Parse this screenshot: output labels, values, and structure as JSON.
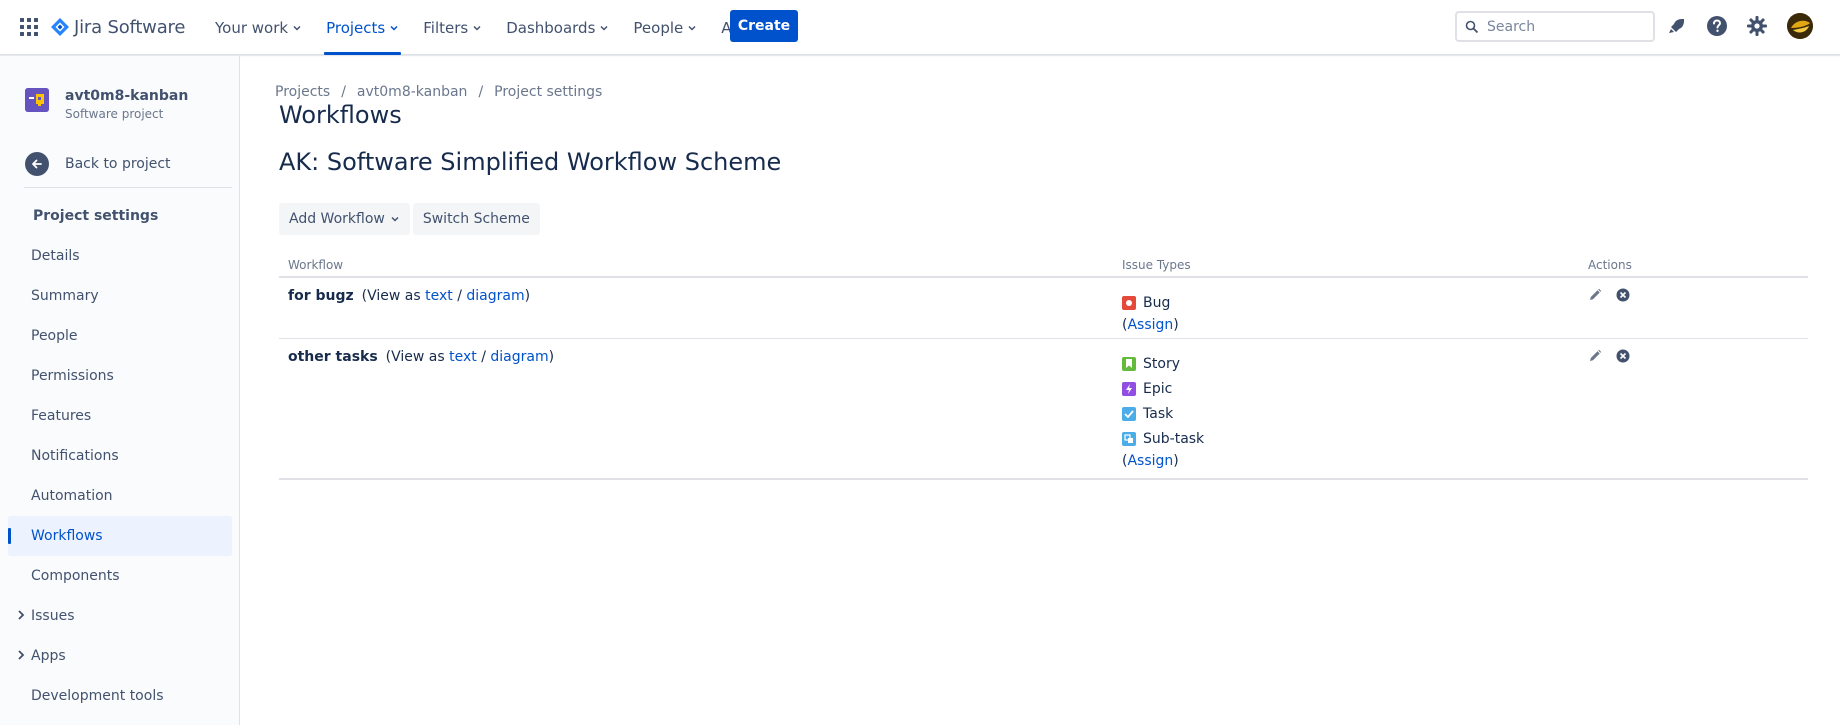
{
  "app": {
    "name": "Jira Software"
  },
  "topnav": {
    "items": [
      {
        "label": "Your work",
        "active": false
      },
      {
        "label": "Projects",
        "active": true
      },
      {
        "label": "Filters",
        "active": false
      },
      {
        "label": "Dashboards",
        "active": false
      },
      {
        "label": "People",
        "active": false
      },
      {
        "label": "Apps",
        "active": false
      }
    ],
    "create_label": "Create",
    "search_placeholder": "Search",
    "icons": [
      "apps-grid-icon",
      "notifications-icon",
      "help-icon",
      "settings-icon",
      "user-avatar"
    ]
  },
  "sidebar": {
    "project_name": "avt0m8-kanban",
    "project_type": "Software project",
    "back_label": "Back to project",
    "section_title": "Project settings",
    "items": [
      {
        "label": "Details",
        "active": false,
        "expandable": false
      },
      {
        "label": "Summary",
        "active": false,
        "expandable": false
      },
      {
        "label": "People",
        "active": false,
        "expandable": false
      },
      {
        "label": "Permissions",
        "active": false,
        "expandable": false
      },
      {
        "label": "Features",
        "active": false,
        "expandable": false
      },
      {
        "label": "Notifications",
        "active": false,
        "expandable": false
      },
      {
        "label": "Automation",
        "active": false,
        "expandable": false
      },
      {
        "label": "Workflows",
        "active": true,
        "expandable": false
      },
      {
        "label": "Components",
        "active": false,
        "expandable": false
      },
      {
        "label": "Issues",
        "active": false,
        "expandable": true
      },
      {
        "label": "Apps",
        "active": false,
        "expandable": true
      },
      {
        "label": "Development tools",
        "active": false,
        "expandable": false
      }
    ]
  },
  "breadcrumb": [
    "Projects",
    "avt0m8-kanban",
    "Project settings"
  ],
  "page": {
    "title": "Workflows",
    "scheme_title": "AK: Software Simplified Workflow Scheme",
    "add_workflow_label": "Add Workflow",
    "switch_scheme_label": "Switch Scheme"
  },
  "table": {
    "headers": {
      "workflow": "Workflow",
      "issue_types": "Issue Types",
      "actions": "Actions"
    },
    "view_as_prefix": "(View as ",
    "view_text_label": "text",
    "view_sep": " / ",
    "view_diagram_label": "diagram",
    "view_suffix": ")",
    "assign_label": "Assign",
    "rows": [
      {
        "name": "for bugz",
        "issue_types": [
          {
            "name": "Bug",
            "icon": "bug-icon",
            "color": "#e5493a"
          }
        ]
      },
      {
        "name": "other tasks",
        "issue_types": [
          {
            "name": "Story",
            "icon": "story-icon",
            "color": "#63ba3c"
          },
          {
            "name": "Epic",
            "icon": "epic-icon",
            "color": "#904ee2"
          },
          {
            "name": "Task",
            "icon": "task-icon",
            "color": "#4bade8"
          },
          {
            "name": "Sub-task",
            "icon": "subtask-icon",
            "color": "#4bade8"
          }
        ]
      }
    ]
  },
  "colors": {
    "brand": "#0052cc",
    "text": "#172b4d",
    "subtle": "#6b778c"
  }
}
